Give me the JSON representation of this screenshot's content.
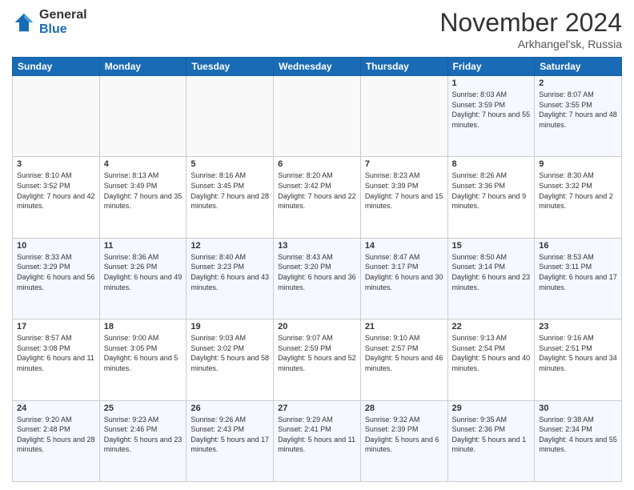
{
  "header": {
    "logo_general": "General",
    "logo_blue": "Blue",
    "month_title": "November 2024",
    "location": "Arkhangel'sk, Russia"
  },
  "days_of_week": [
    "Sunday",
    "Monday",
    "Tuesday",
    "Wednesday",
    "Thursday",
    "Friday",
    "Saturday"
  ],
  "weeks": [
    [
      {
        "day": "",
        "empty": true
      },
      {
        "day": "",
        "empty": true
      },
      {
        "day": "",
        "empty": true
      },
      {
        "day": "",
        "empty": true
      },
      {
        "day": "",
        "empty": true
      },
      {
        "day": "1",
        "sunrise": "8:03 AM",
        "sunset": "3:59 PM",
        "daylight": "7 hours and 55 minutes."
      },
      {
        "day": "2",
        "sunrise": "8:07 AM",
        "sunset": "3:55 PM",
        "daylight": "7 hours and 48 minutes."
      }
    ],
    [
      {
        "day": "3",
        "sunrise": "8:10 AM",
        "sunset": "3:52 PM",
        "daylight": "7 hours and 42 minutes."
      },
      {
        "day": "4",
        "sunrise": "8:13 AM",
        "sunset": "3:49 PM",
        "daylight": "7 hours and 35 minutes."
      },
      {
        "day": "5",
        "sunrise": "8:16 AM",
        "sunset": "3:45 PM",
        "daylight": "7 hours and 28 minutes."
      },
      {
        "day": "6",
        "sunrise": "8:20 AM",
        "sunset": "3:42 PM",
        "daylight": "7 hours and 22 minutes."
      },
      {
        "day": "7",
        "sunrise": "8:23 AM",
        "sunset": "3:39 PM",
        "daylight": "7 hours and 15 minutes."
      },
      {
        "day": "8",
        "sunrise": "8:26 AM",
        "sunset": "3:36 PM",
        "daylight": "7 hours and 9 minutes."
      },
      {
        "day": "9",
        "sunrise": "8:30 AM",
        "sunset": "3:32 PM",
        "daylight": "7 hours and 2 minutes."
      }
    ],
    [
      {
        "day": "10",
        "sunrise": "8:33 AM",
        "sunset": "3:29 PM",
        "daylight": "6 hours and 56 minutes."
      },
      {
        "day": "11",
        "sunrise": "8:36 AM",
        "sunset": "3:26 PM",
        "daylight": "6 hours and 49 minutes."
      },
      {
        "day": "12",
        "sunrise": "8:40 AM",
        "sunset": "3:23 PM",
        "daylight": "6 hours and 43 minutes."
      },
      {
        "day": "13",
        "sunrise": "8:43 AM",
        "sunset": "3:20 PM",
        "daylight": "6 hours and 36 minutes."
      },
      {
        "day": "14",
        "sunrise": "8:47 AM",
        "sunset": "3:17 PM",
        "daylight": "6 hours and 30 minutes."
      },
      {
        "day": "15",
        "sunrise": "8:50 AM",
        "sunset": "3:14 PM",
        "daylight": "6 hours and 23 minutes."
      },
      {
        "day": "16",
        "sunrise": "8:53 AM",
        "sunset": "3:11 PM",
        "daylight": "6 hours and 17 minutes."
      }
    ],
    [
      {
        "day": "17",
        "sunrise": "8:57 AM",
        "sunset": "3:08 PM",
        "daylight": "6 hours and 11 minutes."
      },
      {
        "day": "18",
        "sunrise": "9:00 AM",
        "sunset": "3:05 PM",
        "daylight": "6 hours and 5 minutes."
      },
      {
        "day": "19",
        "sunrise": "9:03 AM",
        "sunset": "3:02 PM",
        "daylight": "5 hours and 58 minutes."
      },
      {
        "day": "20",
        "sunrise": "9:07 AM",
        "sunset": "2:59 PM",
        "daylight": "5 hours and 52 minutes."
      },
      {
        "day": "21",
        "sunrise": "9:10 AM",
        "sunset": "2:57 PM",
        "daylight": "5 hours and 46 minutes."
      },
      {
        "day": "22",
        "sunrise": "9:13 AM",
        "sunset": "2:54 PM",
        "daylight": "5 hours and 40 minutes."
      },
      {
        "day": "23",
        "sunrise": "9:16 AM",
        "sunset": "2:51 PM",
        "daylight": "5 hours and 34 minutes."
      }
    ],
    [
      {
        "day": "24",
        "sunrise": "9:20 AM",
        "sunset": "2:48 PM",
        "daylight": "5 hours and 28 minutes."
      },
      {
        "day": "25",
        "sunrise": "9:23 AM",
        "sunset": "2:46 PM",
        "daylight": "5 hours and 23 minutes."
      },
      {
        "day": "26",
        "sunrise": "9:26 AM",
        "sunset": "2:43 PM",
        "daylight": "5 hours and 17 minutes."
      },
      {
        "day": "27",
        "sunrise": "9:29 AM",
        "sunset": "2:41 PM",
        "daylight": "5 hours and 11 minutes."
      },
      {
        "day": "28",
        "sunrise": "9:32 AM",
        "sunset": "2:39 PM",
        "daylight": "5 hours and 6 minutes."
      },
      {
        "day": "29",
        "sunrise": "9:35 AM",
        "sunset": "2:36 PM",
        "daylight": "5 hours and 1 minute."
      },
      {
        "day": "30",
        "sunrise": "9:38 AM",
        "sunset": "2:34 PM",
        "daylight": "4 hours and 55 minutes."
      }
    ]
  ]
}
